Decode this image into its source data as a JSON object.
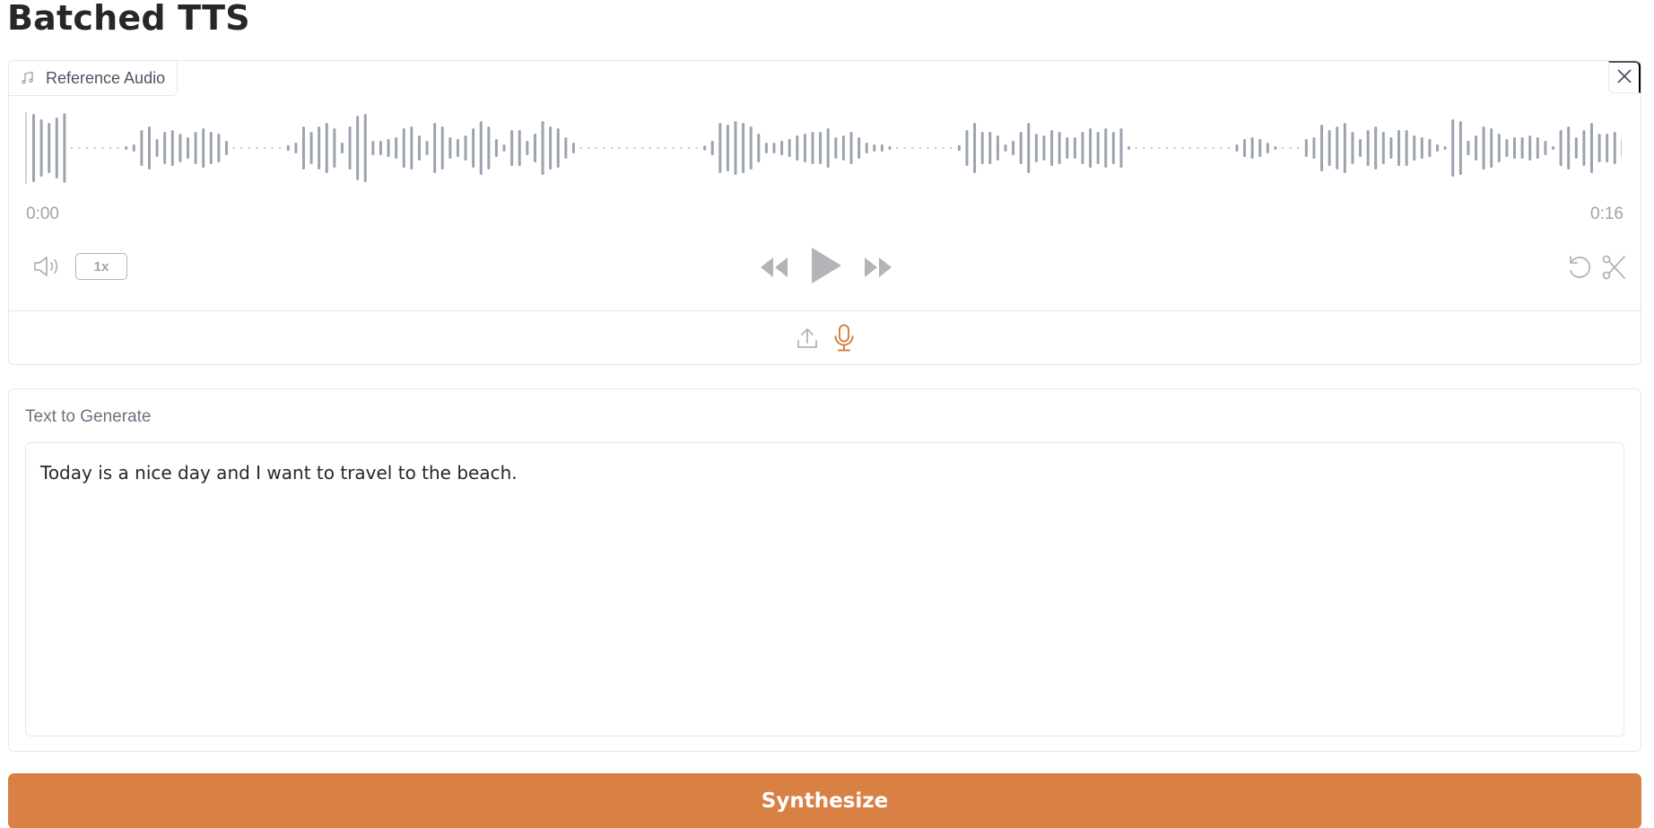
{
  "page": {
    "title": "Batched TTS"
  },
  "reference_audio": {
    "label": "Reference Audio",
    "label_icon": "music-note-icon",
    "close_icon": "close-icon",
    "time_start": "0:00",
    "time_end": "0:16",
    "playback_rate": "1x",
    "icons": {
      "volume": "volume-icon",
      "rewind": "rewind-icon",
      "play": "play-icon",
      "forward": "fast-forward-icon",
      "undo": "undo-icon",
      "trim": "scissors-icon",
      "upload": "upload-icon",
      "microphone": "microphone-icon"
    },
    "colors": {
      "waveform": "#9ca3af",
      "controls": "#b4b4b8",
      "accent": "#d98145"
    },
    "waveform_amplitudes": [
      0.95,
      0.8,
      0.7,
      0.85,
      0.97,
      0,
      0,
      0,
      0,
      0,
      0,
      0,
      0.05,
      0.1,
      0.5,
      0.6,
      0.25,
      0.45,
      0.5,
      0.4,
      0.3,
      0.45,
      0.55,
      0.45,
      0.4,
      0.2,
      0,
      0,
      0,
      0,
      0,
      0,
      0,
      0.08,
      0.15,
      0.6,
      0.45,
      0.6,
      0.7,
      0.55,
      0.15,
      0.6,
      0.9,
      0.95,
      0.2,
      0.2,
      0.25,
      0.3,
      0.55,
      0.6,
      0.35,
      0.2,
      0.7,
      0.6,
      0.3,
      0.25,
      0.35,
      0.55,
      0.75,
      0.6,
      0.25,
      0.1,
      0.5,
      0.5,
      0.2,
      0.4,
      0.75,
      0.6,
      0.55,
      0.3,
      0.15,
      0,
      0,
      0,
      0,
      0,
      0,
      0,
      0,
      0,
      0,
      0,
      0,
      0,
      0,
      0,
      0,
      0.07,
      0.2,
      0.7,
      0.65,
      0.75,
      0.7,
      0.6,
      0.4,
      0.15,
      0.15,
      0.2,
      0.25,
      0.35,
      0.4,
      0.45,
      0.45,
      0.55,
      0.3,
      0.35,
      0.45,
      0.3,
      0.15,
      0.1,
      0.1,
      0.05,
      0,
      0,
      0,
      0,
      0,
      0,
      0,
      0,
      0.08,
      0.5,
      0.7,
      0.45,
      0.45,
      0.35,
      0.1,
      0.2,
      0.45,
      0.7,
      0.4,
      0.35,
      0.5,
      0.45,
      0.3,
      0.3,
      0.45,
      0.55,
      0.45,
      0.55,
      0.45,
      0.55,
      0.05,
      0,
      0,
      0,
      0,
      0,
      0,
      0,
      0,
      0,
      0,
      0,
      0,
      0,
      0.1,
      0.25,
      0.3,
      0.25,
      0.15,
      0.05,
      0,
      0,
      0,
      0.25,
      0.3,
      0.65,
      0.5,
      0.6,
      0.7,
      0.45,
      0.25,
      0.5,
      0.6,
      0.45,
      0.3,
      0.5,
      0.5,
      0.35,
      0.3,
      0.25,
      0.1,
      0.05,
      0.8,
      0.75,
      0.2,
      0.35,
      0.6,
      0.55,
      0.4,
      0.25,
      0.3,
      0.3,
      0.35,
      0.3,
      0.2,
      0.05,
      0.5,
      0.6,
      0.3,
      0.5,
      0.7,
      0.4,
      0.4,
      0.45,
      0.25
    ]
  },
  "text_input": {
    "label": "Text to Generate",
    "value": "Today is a nice day and I want to travel to the beach.",
    "placeholder": ""
  },
  "actions": {
    "synthesize_label": "Synthesize"
  }
}
